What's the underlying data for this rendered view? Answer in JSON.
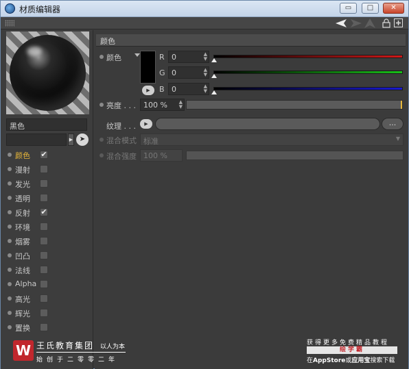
{
  "window": {
    "title": "材质编辑器",
    "minimize_label": "▭",
    "maximize_label": "□",
    "close_label": "✕"
  },
  "left_panel": {
    "material_name": "黑色",
    "channels": [
      {
        "label": "颜色",
        "checked": true,
        "active": true
      },
      {
        "label": "漫射",
        "checked": false
      },
      {
        "label": "发光",
        "checked": false
      },
      {
        "label": "透明",
        "checked": false
      },
      {
        "label": "反射",
        "checked": true
      },
      {
        "label": "环境",
        "checked": false
      },
      {
        "label": "烟雾",
        "checked": false
      },
      {
        "label": "凹凸",
        "checked": false
      },
      {
        "label": "法线",
        "checked": false
      },
      {
        "label": "Alpha",
        "checked": false
      },
      {
        "label": "高光",
        "checked": false
      },
      {
        "label": "辉光",
        "checked": false
      },
      {
        "label": "置换",
        "checked": false
      }
    ]
  },
  "color_section": {
    "header": "颜色",
    "color_label": "颜色",
    "swatch_color": "#000000",
    "r_label": "R",
    "g_label": "G",
    "b_label": "B",
    "r_value": "0",
    "g_value": "0",
    "b_value": "0",
    "r_color": "#d01818",
    "g_color": "#18c018",
    "b_color": "#1818d0",
    "brightness_label": "亮度 . . .",
    "brightness_value": "100 %",
    "texture_label": "纹理 . . .",
    "more_label": "...",
    "blend_mode_label": "混合模式",
    "blend_mode_value": "标准",
    "blend_strength_label": "混合强度",
    "blend_strength_value": "100 %"
  },
  "watermark": {
    "company": "王氏教育集团",
    "slogan": "以人为本",
    "since": "始创于二零零二年",
    "promo_line1": "获得更多免费精品教程",
    "promo_brand": "绘学霸",
    "promo_prefix": "在",
    "promo_store": "AppStore",
    "promo_or": "或",
    "promo_app": "应用宝",
    "promo_suffix": "搜索下载"
  }
}
